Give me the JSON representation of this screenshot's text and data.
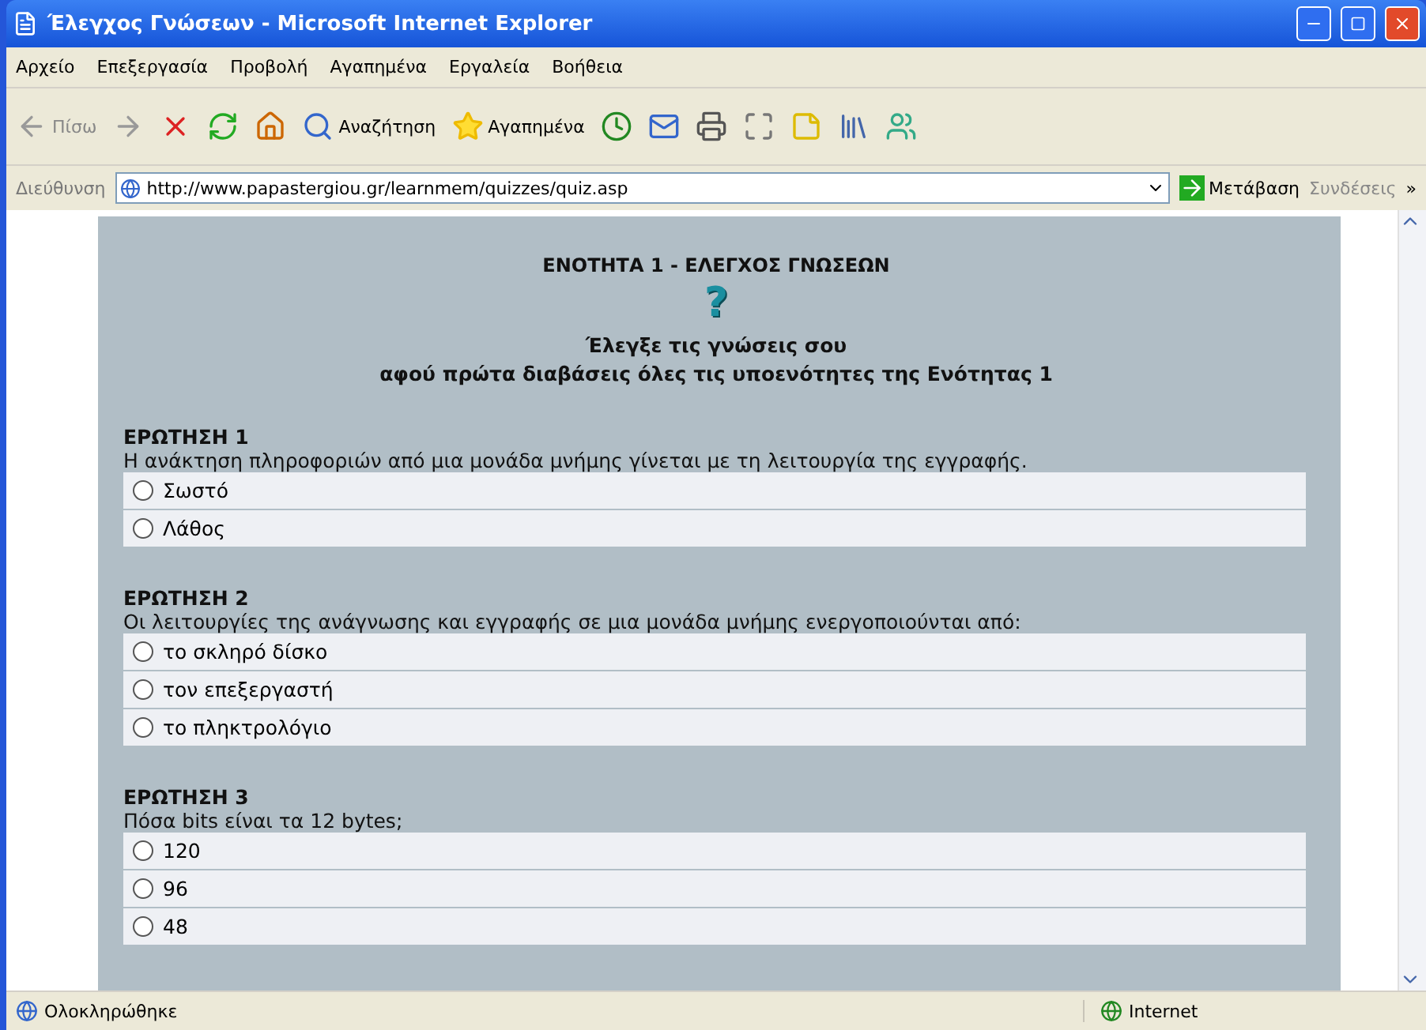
{
  "window": {
    "title": "Έλεγχος Γνώσεων - Microsoft Internet Explorer"
  },
  "menu": [
    "Αρχείο",
    "Επεξεργασία",
    "Προβολή",
    "Αγαπημένα",
    "Εργαλεία",
    "Βοήθεια"
  ],
  "toolbar": {
    "back": "Πίσω",
    "search": "Αναζήτηση",
    "favorites": "Αγαπημένα"
  },
  "address_bar": {
    "label": "Διεύθυνση",
    "url": "http://www.papastergiou.gr/learnmem/quizzes/quiz.asp",
    "go": "Μετάβαση",
    "links": "Συνδέσεις",
    "more": "»"
  },
  "page": {
    "heading": "ΕΝΟΤΗΤΑ 1 - ΕΛΕΓΧΟΣ ΓΝΩΣΕΩΝ",
    "help_mark": "?",
    "intro": [
      "Έλεγξε τις γνώσεις σου",
      "αφού πρώτα διαβάσεις όλες τις υποενότητες της Ενότητας 1"
    ],
    "questions": [
      {
        "title": "ΕΡΩΤΗΣΗ 1",
        "text": "Η ανάκτηση πληροφοριών από μια μονάδα μνήμης γίνεται με τη λειτουργία της εγγραφής.",
        "options": [
          {
            "label": "Σωστό",
            "selected": false
          },
          {
            "label": "Λάθος",
            "selected": false
          }
        ]
      },
      {
        "title": "ΕΡΩΤΗΣΗ 2",
        "text": "Οι λειτουργίες της ανάγνωσης και εγγραφής σε μια μονάδα μνήμης ενεργοποιούνται από:",
        "options": [
          {
            "label": "το σκληρό δίσκο",
            "selected": false
          },
          {
            "label": "τον επεξεργαστή",
            "selected": false
          },
          {
            "label": "το πληκτρολόγιο",
            "selected": false
          }
        ]
      },
      {
        "title": "ΕΡΩΤΗΣΗ 3",
        "text": "Πόσα bits είναι τα 12 bytes;",
        "options": [
          {
            "label": "120",
            "selected": false
          },
          {
            "label": "96",
            "selected": false
          },
          {
            "label": "48",
            "selected": false
          }
        ]
      }
    ]
  },
  "status_bar": {
    "text": "Ολοκληρώθηκε",
    "zone": "Internet"
  }
}
